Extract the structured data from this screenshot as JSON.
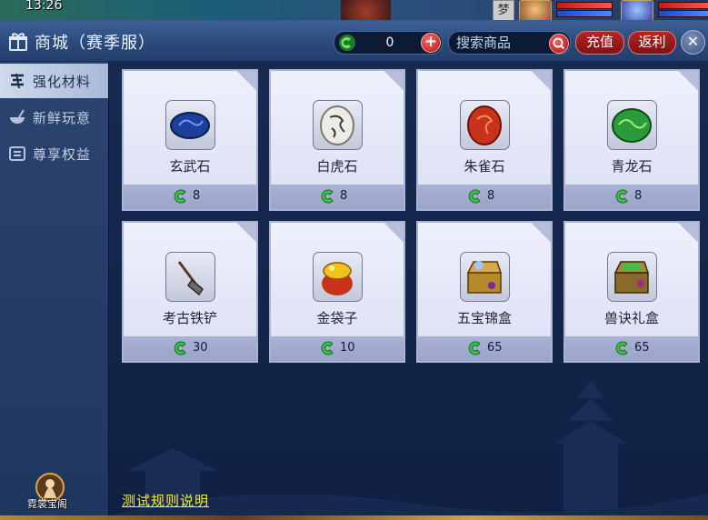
{
  "hud": {
    "clock": "13:26",
    "dream_badge": "梦"
  },
  "window": {
    "title": "商城（赛季服）",
    "currency": {
      "icon": "jade-currency-icon",
      "value": "0",
      "add_label": "+"
    },
    "search": {
      "placeholder": "搜索商品"
    },
    "recharge_label": "充值",
    "rebate_label": "返利",
    "close_label": "✕"
  },
  "sidebar": {
    "items": [
      {
        "label": "强化材料",
        "icon": "upgrade-icon",
        "active": true
      },
      {
        "label": "新鲜玩意",
        "icon": "bowl-icon",
        "active": false
      },
      {
        "label": "尊享权益",
        "icon": "privilege-icon",
        "active": false
      }
    ],
    "bottom_label": "霓裳宝阁"
  },
  "products": [
    {
      "name": "玄武石",
      "price": "8",
      "color": "#1d3f9a"
    },
    {
      "name": "白虎石",
      "price": "8",
      "color": "#e8e6de"
    },
    {
      "name": "朱雀石",
      "price": "8",
      "color": "#c8321a"
    },
    {
      "name": "青龙石",
      "price": "8",
      "color": "#2a9a3a"
    },
    {
      "name": "考古铁铲",
      "price": "30",
      "color": "#6a6a6a"
    },
    {
      "name": "金袋子",
      "price": "10",
      "color": "#d9a21a"
    },
    {
      "name": "五宝锦盒",
      "price": "65",
      "color": "#b8892a"
    },
    {
      "name": "兽诀礼盒",
      "price": "65",
      "color": "#8a6a2a"
    }
  ],
  "footer": {
    "rules_link": "测试规则说明"
  },
  "colors": {
    "accent_red": "#b52424",
    "card_bg": "#e6e9f8",
    "price_bar": "#a3abd0",
    "jade_green": "#3cc04a",
    "rules_link": "#f6ec3c"
  }
}
